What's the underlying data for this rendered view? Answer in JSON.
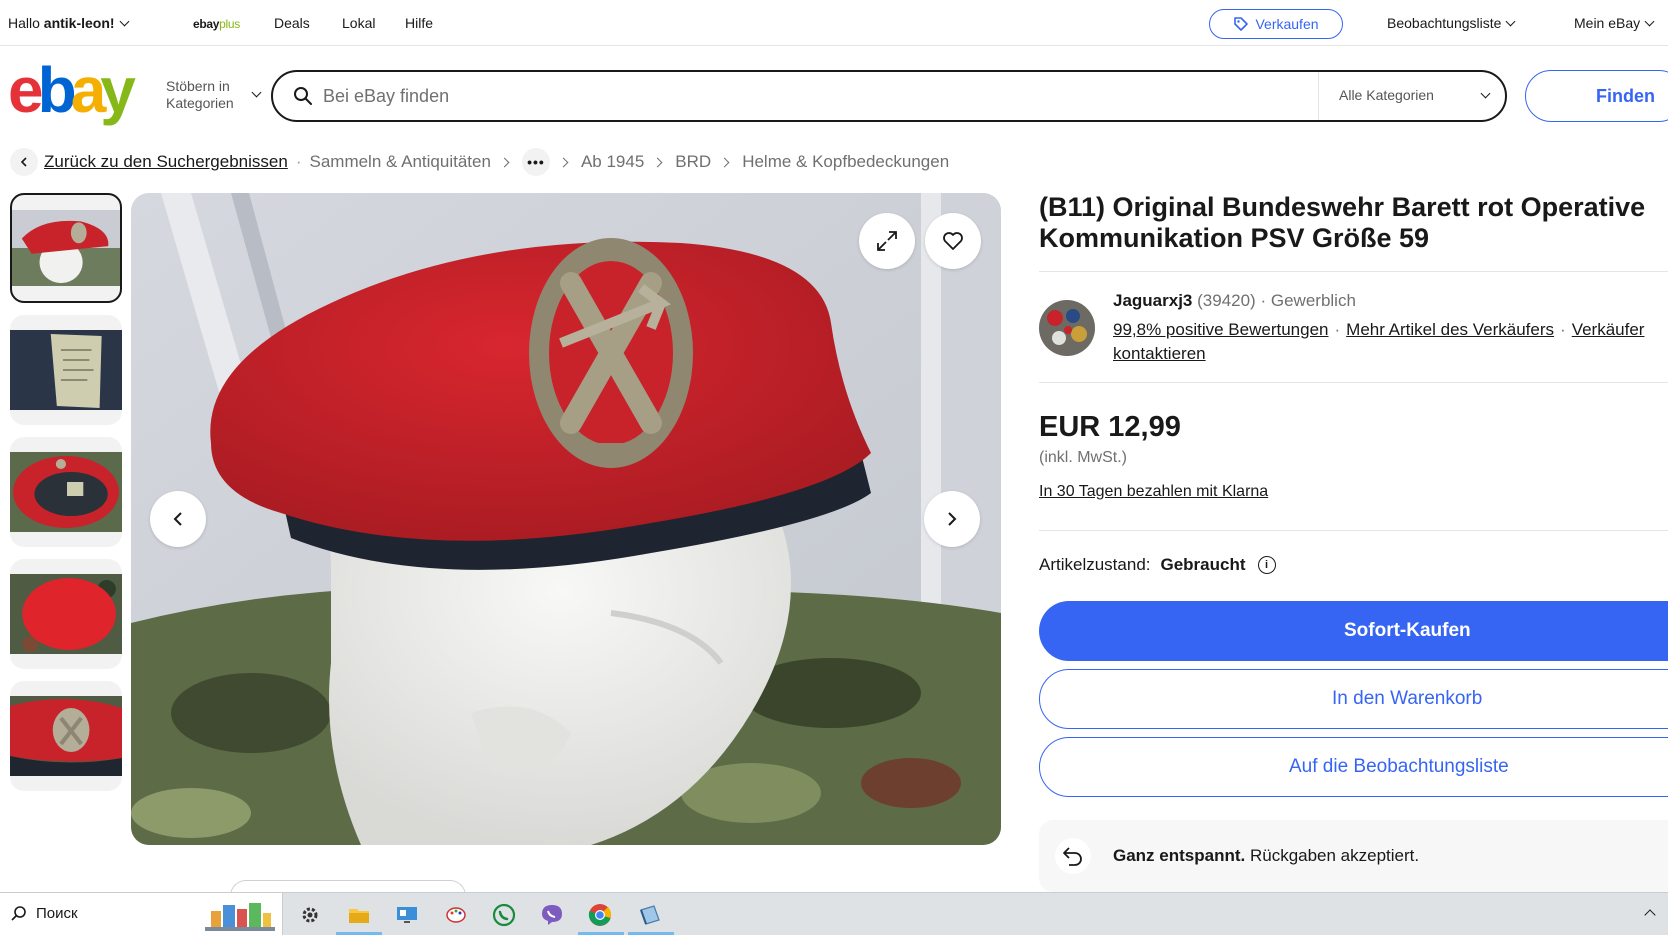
{
  "topbar": {
    "greeting_prefix": "Hallo ",
    "user_name": "antik-leon!",
    "ebayplus_a": "ebay",
    "ebayplus_b": "plus",
    "deals": "Deals",
    "lokal": "Lokal",
    "hilfe": "Hilfe",
    "sell": "Verkaufen",
    "watchlist": "Beobachtungsliste",
    "my_ebay": "Mein eBay"
  },
  "header": {
    "logo": [
      "e",
      "b",
      "a",
      "y"
    ],
    "shop_by_category_1": "Stöbern in",
    "shop_by_category_2": "Kategorien",
    "search_placeholder": "Bei eBay finden",
    "category_select": "Alle Kategorien",
    "find_button": "Finden"
  },
  "breadcrumb": {
    "back": "Zurück zu den Suchergebnissen",
    "items": [
      "Sammeln & Antiquitäten",
      "Ab 1945",
      "BRD",
      "Helme & Kopfbedeckungen"
    ],
    "more": "•••"
  },
  "listing": {
    "title": "(B11) Original Bundeswehr Barett rot Operative Kommunikation PSV Größe 59",
    "seller": {
      "name": "Jaguarxj3",
      "feedback_count": "(39420)",
      "separator": "·",
      "type": "Gewerblich",
      "positive": "99,8% positive Bewertungen",
      "more_items": "Mehr Artikel des Verkäufers",
      "contact": "Verkäufer kontaktieren"
    },
    "price": "EUR 12,99",
    "vat": "(inkl. MwSt.)",
    "klarna": "In 30 Tagen bezahlen mit Klarna",
    "condition_label": "Artikelzustand:",
    "condition_value": "Gebraucht",
    "condition_info": "i",
    "buy_now": "Sofort-Kaufen",
    "add_to_cart": "In den Warenkorb",
    "add_to_watchlist": "Auf die Beobachtungsliste",
    "returns_bold": "Ganz entspannt.",
    "returns_text": " Rückgaben akzeptiert."
  },
  "taskbar": {
    "search_placeholder": "Поиск"
  },
  "colors": {
    "accent": "#3665f3",
    "beret_red": "#c8232b"
  }
}
